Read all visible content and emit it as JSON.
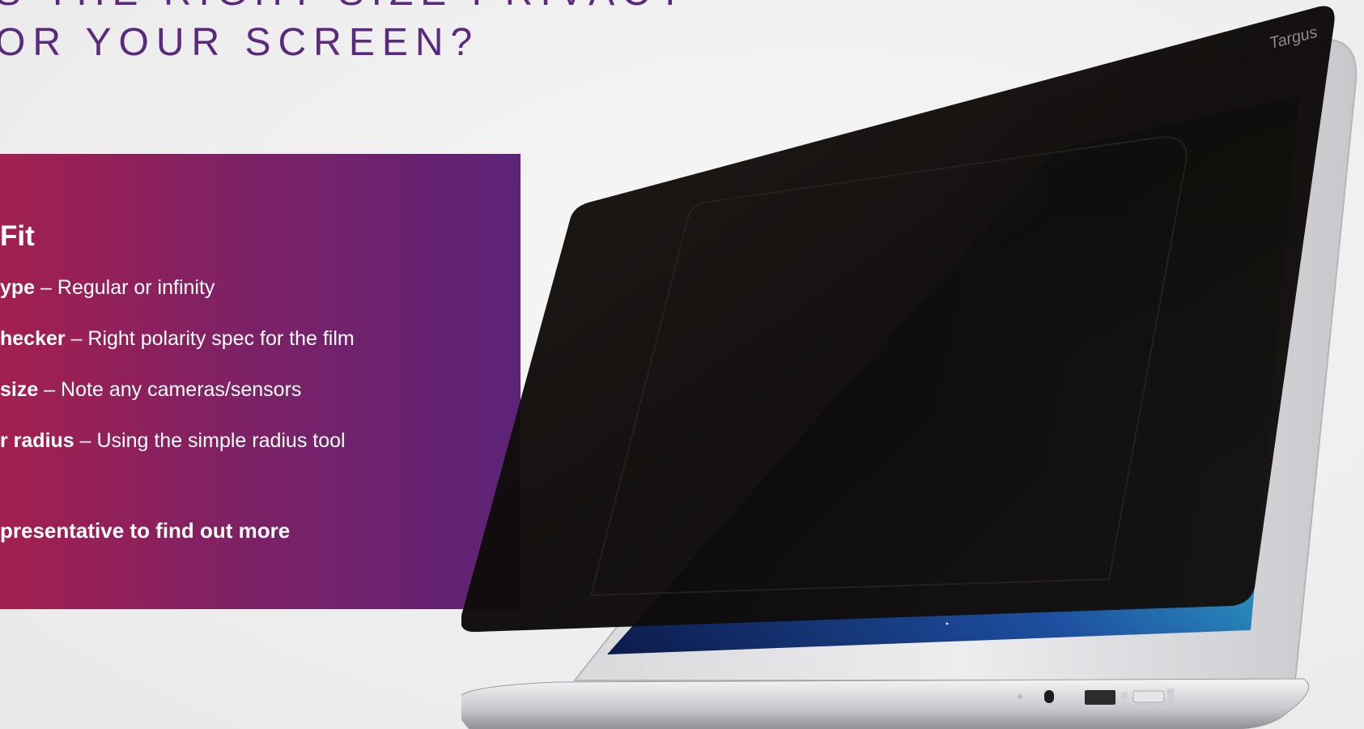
{
  "headline": {
    "line1": "S THE RIGHT SIZE PRIVACY",
    "line2": "OR YOUR SCREEN?"
  },
  "panel": {
    "title": "Fit",
    "items": [
      {
        "bold": "ype",
        "text": " – Regular or infinity"
      },
      {
        "bold": "hecker",
        "text": " – Right polarity spec for the film"
      },
      {
        "bold": "size",
        "text": " – Note any cameras/sensors"
      },
      {
        "bold": "r radius",
        "text": " – Using the simple radius tool"
      }
    ],
    "cta": "presentative to find out more"
  },
  "product": {
    "brand": "Targus"
  },
  "colors": {
    "headline": "#5a2a7e",
    "panel_start": "#a3204f",
    "panel_end": "#5c2378"
  }
}
